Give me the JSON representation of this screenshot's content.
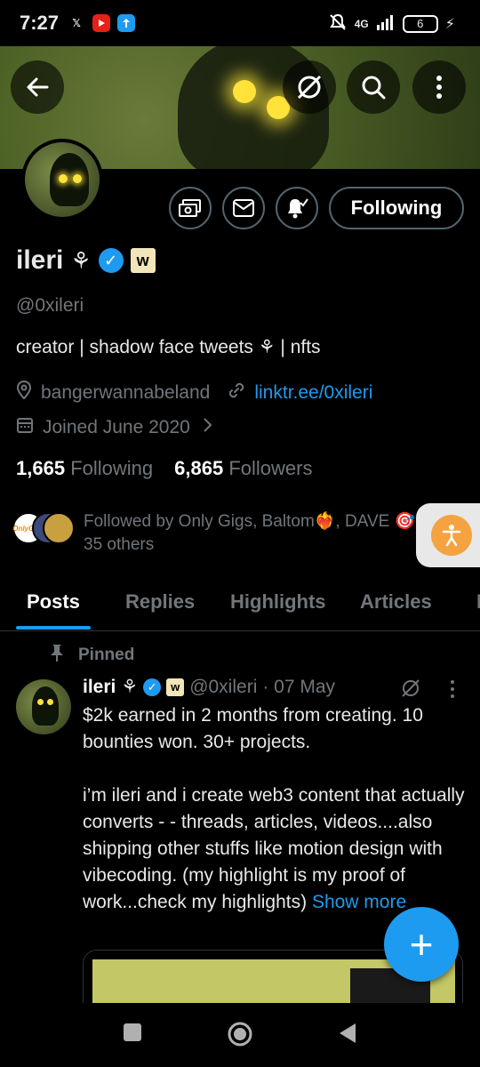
{
  "status": {
    "time": "7:27",
    "network": "4G",
    "battery": "6"
  },
  "profile": {
    "name": "ileri",
    "name_glyph": "⚘",
    "badge_letter": "w",
    "handle": "@0xileri",
    "bio": "creator | shadow face tweets ⚘ | nfts",
    "location": "bangerwannabeland",
    "link": "linktr.ee/0xileri",
    "joined": "Joined June 2020",
    "following_count": "1,665",
    "following_label": "Following",
    "followers_count": "6,865",
    "followers_label": "Followers",
    "followed_by": "Followed by Only Gigs, Baltom❤️‍🔥, DAVE 🎯",
    "followed_by_more": "35 others",
    "follow_button": "Following"
  },
  "tabs": [
    "Posts",
    "Replies",
    "Highlights",
    "Articles",
    "Me"
  ],
  "post": {
    "pinned_label": "Pinned",
    "author": "ileri",
    "handle": "@0xileri",
    "date": "· 07 May",
    "line1": "$2k earned in 2 months from creating. 10 bounties won. 30+ projects.",
    "line2": "i’m ileri and i create web3 content that actually converts - - threads, articles, videos....also shipping other stuffs like motion design with vibecoding. (my highlight is my proof of work...check my highlights)",
    "show_more": "Show more"
  },
  "fab_label": "+",
  "colors": {
    "accent": "#1d9bf0",
    "background": "#000000",
    "muted": "#71767b"
  }
}
